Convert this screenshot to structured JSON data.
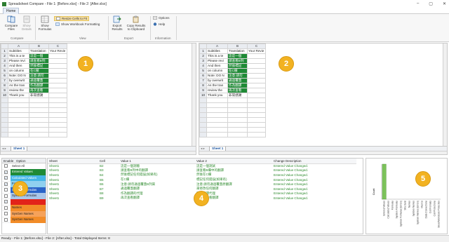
{
  "window": {
    "title": "Spreadsheet Compare - File 1: [Before.xlsx] - File 2: [After.xlsx]",
    "min": "–",
    "max": "▢",
    "close": "✕"
  },
  "menu": {
    "home": "Home"
  },
  "ribbon": {
    "compare_files": "Compare Files",
    "show_details": "Show Details",
    "show_formulas": "Show Formulas",
    "resize_cells": "Resize Cells to Fit",
    "show_workbook_formatting": "Show Workbook Formatting",
    "export_results": "Export Results",
    "copy_results": "Copy Results to Clipboard",
    "options": "Options",
    "help": "Help",
    "groups": {
      "compare": "Compare",
      "view": "View",
      "export": "Export",
      "information": "Information"
    }
  },
  "grid": {
    "columns": [
      "A",
      "B",
      "C"
    ],
    "rows": [
      {
        "n": "1",
        "a": "Subtitles",
        "b": "Translation",
        "c": "Your Revie",
        "bg": false
      },
      {
        "n": "2",
        "a": "This is a te",
        "b": "這是一個",
        "c": "",
        "bg": true
      },
      {
        "n": "3",
        "a": "Please revi",
        "b": "請查看B列",
        "c": "",
        "bg": true
      },
      {
        "n": "4",
        "a": "And then",
        "b": "然後標記",
        "c": "",
        "bg": true
      },
      {
        "n": "5",
        "a": "on column",
        "b": "在C欄",
        "c": "",
        "bg": true
      },
      {
        "n": "6",
        "a": "Note: DO N",
        "b": "注意:請勿",
        "c": "",
        "bg": true
      },
      {
        "n": "7",
        "a": "by overwrit",
        "b": "通過覆蓋",
        "c": "",
        "bg": true
      },
      {
        "n": "8",
        "a": "As the tran",
        "b": "作為翻譯",
        "c": "",
        "bg": true
      },
      {
        "n": "9",
        "a": "review the",
        "b": "再次查看",
        "c": "",
        "bg": true
      },
      {
        "n": "10",
        "a": "Thank you",
        "b": "非常感謝",
        "c": "",
        "bg": false
      }
    ]
  },
  "sheet_tab": "Sheet 1",
  "options_panel": {
    "headers": {
      "enable": "Enable",
      "option": "Option"
    },
    "items": [
      {
        "label": "Select All",
        "color": "#ffffff",
        "text": "#222",
        "checked": ""
      },
      {
        "label": "Entered Values",
        "color": "#1f8a36",
        "text": "#fff",
        "checked": "✓"
      },
      {
        "label": "Calculated Values",
        "color": "#46b6e6",
        "text": "#fff",
        "checked": "✓"
      },
      {
        "label": "Formulas",
        "color": "#8fd0ef",
        "text": "#222",
        "checked": "✓"
      },
      {
        "label": "SysGen Formulas",
        "color": "#2a64c8",
        "text": "#fff",
        "checked": ""
      },
      {
        "label": "SysGen Formulas",
        "color": "#a9c6ea",
        "text": "#222",
        "checked": ""
      },
      {
        "label": "",
        "color": "#e2231a",
        "text": "#fff",
        "checked": "✓"
      },
      {
        "label": "Names",
        "color": "#f28c28",
        "text": "#222",
        "checked": ""
      },
      {
        "label": "SysGen Names",
        "color": "#f6a25a",
        "text": "#222",
        "checked": ""
      },
      {
        "label": "SysGen Names",
        "color": "#f28c28",
        "text": "#222",
        "checked": ""
      }
    ]
  },
  "results": {
    "headers": {
      "sheet": "Sheet",
      "cell": "Cell",
      "value1": "Value 1",
      "value2": "Value 2",
      "change": "Change Description"
    },
    "rows": [
      {
        "sheet": "Sheet1",
        "cell": "B2",
        "v1": "這是一個測驗",
        "v2": "這是一個測試",
        "change": "Entered Value Changed."
      },
      {
        "sheet": "Sheet1",
        "cell": "B3",
        "v1": "請查看B列中的翻譯",
        "v2": "請查看B欄中的翻譯",
        "change": "Entered Value Changed."
      },
      {
        "sheet": "Sheet1",
        "cell": "B4",
        "v1": "然後標記任何錯誤(如果有)",
        "v2": "然後在C欄",
        "change": "Entered Value Changed."
      },
      {
        "sheet": "Sheet1",
        "cell": "B5",
        "v1": "在C欄",
        "v2": "標記任何錯誤(如果有)",
        "change": "Entered Value Changed."
      },
      {
        "sheet": "Sheet1",
        "cell": "B6",
        "v1": "注意:請勿通過覆蓋B列來",
        "v2": "注意:請勿通過覆蓋原翻譯",
        "change": "Entered Value Changed."
      },
      {
        "sheet": "Sheet1",
        "cell": "B7",
        "v1": "通過覆蓋翻譯",
        "v2": "來修改任何翻譯",
        "change": "Entered Value Changed."
      },
      {
        "sheet": "Sheet1",
        "cell": "B8",
        "v1": "作為翻譯的代理",
        "v2": "因為翻譯代理",
        "change": "Entered Value Changed."
      },
      {
        "sheet": "Sheet1",
        "cell": "B9",
        "v1": "再次查看翻譯",
        "v2": "會再次查看翻譯",
        "change": "Entered Value Changed."
      }
    ]
  },
  "callouts": [
    "1",
    "2",
    "3",
    "4",
    "5"
  ],
  "chart_data": {
    "type": "bar",
    "ylabel": "Count",
    "categories": [
      "Entered Values",
      "Calculated Values",
      "Formulas",
      "SysGen Formulas",
      "SysGen Formulas (Errors)",
      "Structural",
      "Names",
      "SysGen Names",
      "SysGen Names (Errors)",
      "Macros",
      "Data Connections",
      "Cell Formats",
      "Cell Protections",
      "Sheet/Workbook Protection"
    ],
    "values": [
      8,
      0,
      0,
      0,
      0,
      0,
      0,
      0,
      0,
      0,
      0,
      0,
      0,
      0
    ],
    "ylim": [
      0,
      8
    ],
    "color": "#7cc35a"
  },
  "status": {
    "text": "Ready - File 1: [Before.xlsx] - File 2: [After.xlsx] - Total Displayed Items: 8"
  }
}
